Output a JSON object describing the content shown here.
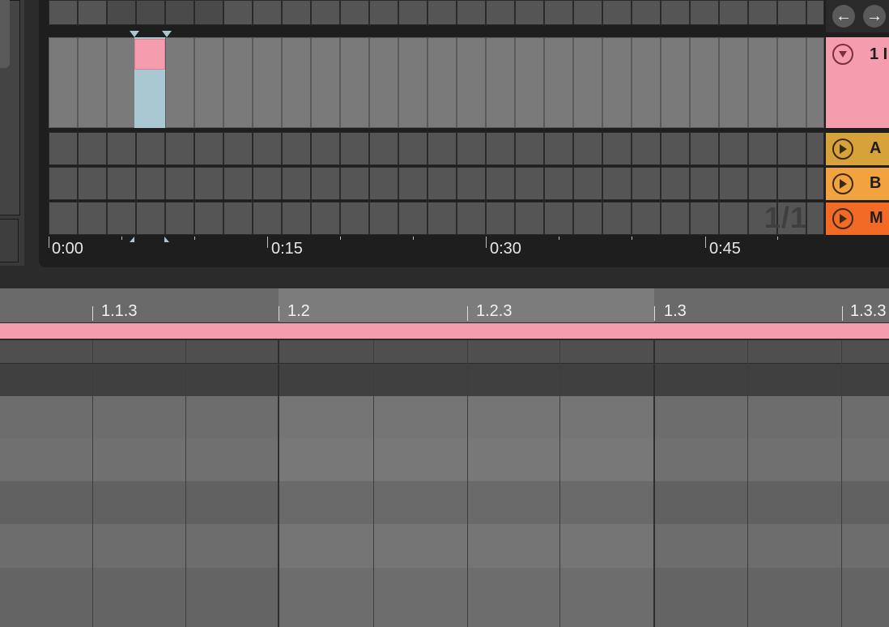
{
  "overview": {
    "timeline_labels": [
      "0:00",
      "0:15",
      "0:30",
      "0:45"
    ],
    "pager_text": "1/1"
  },
  "navigation": {
    "back_glyph": "←",
    "forward_glyph": "→"
  },
  "tracks": [
    {
      "name": "1 I",
      "icon": "fold-arrow-down-icon",
      "color": "#f49daf"
    },
    {
      "name": "A",
      "icon": "play-icon",
      "color": "#d8a23b"
    },
    {
      "name": "B",
      "icon": "play-icon",
      "color": "#f2a23f"
    },
    {
      "name": "M",
      "icon": "play-icon",
      "color": "#f26a25"
    }
  ],
  "arrangement": {
    "ruler_labels": [
      "1.1.3",
      "1.2",
      "1.2.3",
      "1.3",
      "1.3.3"
    ],
    "clip_color": "#f49daf"
  }
}
